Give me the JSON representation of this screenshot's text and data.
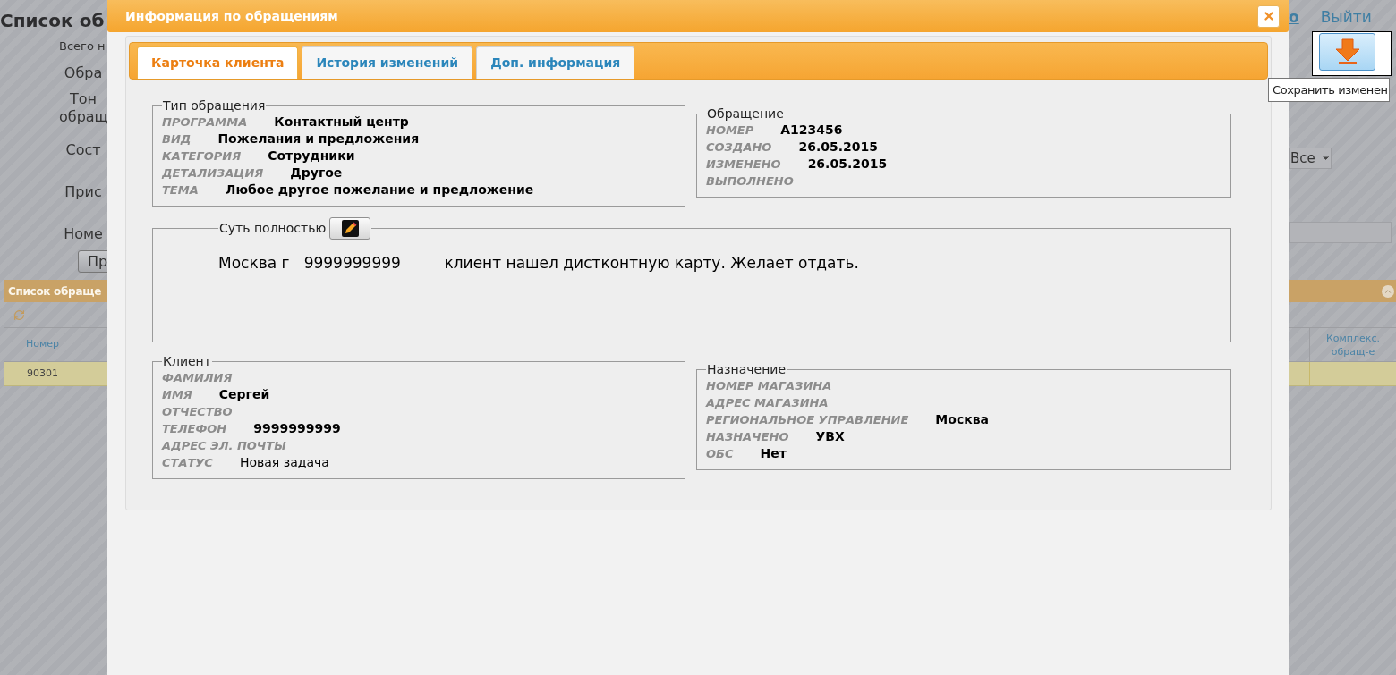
{
  "background": {
    "title": "Список об",
    "subtitle": "Всего н",
    "filters": [
      {
        "label": "Обра"
      },
      {
        "label": "Тон\nобращ"
      },
      {
        "label": "Сост"
      },
      {
        "label": "Прис"
      },
      {
        "label": "Номе"
      }
    ],
    "search_button": "Пр",
    "header_link": "о",
    "logout": "Выйти",
    "save_tooltip": "Сохранить изменен",
    "status_select": "Все",
    "list_panel": {
      "title": "Список обраще",
      "columns": [
        "Номер",
        "Комплекс. обращ-е"
      ],
      "rows": [
        {
          "number": "90301",
          "selected": true
        }
      ]
    }
  },
  "modal": {
    "title": "Информация по обращениям",
    "tabs": [
      {
        "label": "Карточка клиента",
        "selected": true
      },
      {
        "label": "История изменений",
        "selected": false
      },
      {
        "label": "Доп. информация",
        "selected": false
      }
    ],
    "request_type": {
      "legend": "Тип обращения",
      "rows": [
        {
          "label": "ПРОГРАММА",
          "value": "Контактный центр",
          "bold": true
        },
        {
          "label": "ВИД",
          "value": "Пожелания и предложения",
          "bold": true
        },
        {
          "label": "КАТЕГОРИЯ",
          "value": "Сотрудники",
          "bold": true
        },
        {
          "label": "ДЕТАЛИЗАЦИЯ",
          "value": "Другое",
          "bold": true
        },
        {
          "label": "ТЕМА",
          "value": "Любое другое пожелание и предложение",
          "bold": true
        }
      ]
    },
    "request": {
      "legend": "Обращение",
      "rows": [
        {
          "label": "НОМЕР",
          "value": "A123456",
          "bold": true
        },
        {
          "label": "СОЗДАНО",
          "value": "26.05.2015",
          "bold": true
        },
        {
          "label": "ИЗМЕНЕНО",
          "value": "26.05.2015",
          "bold": true
        },
        {
          "label": "ВЫПОЛНЕНО"
        }
      ]
    },
    "summary": {
      "legend": "Суть полностью",
      "text": "Москва г   9999999999         клиент нашел дистконтную карту. Желает отдать."
    },
    "client": {
      "legend": "Клиент",
      "rows": [
        {
          "label": "ФАМИЛИЯ"
        },
        {
          "label": "ИМЯ",
          "value": "Сергей",
          "bold": true
        },
        {
          "label": "ОТЧЕСТВО"
        },
        {
          "label": "ТЕЛЕФОН",
          "value": "9999999999",
          "bold": true
        },
        {
          "label": "АДРЕС ЭЛ. ПОЧТЫ"
        },
        {
          "label": "СТАТУС",
          "value": "Новая задача",
          "bold": false
        }
      ]
    },
    "assignment": {
      "legend": "Назначение",
      "rows": [
        {
          "label": "НОМЕР МАГАЗИНА"
        },
        {
          "label": "АДРЕС МАГАЗИНА"
        },
        {
          "label": "РЕГИОНАЛЬНОЕ УПРАВЛЕНИЕ",
          "value": "Москва",
          "bold": true
        },
        {
          "label": "НАЗНАЧЕНО",
          "value": "УВХ",
          "bold": true
        },
        {
          "label": "ОБС",
          "value": "Нет",
          "bold": true
        }
      ]
    }
  }
}
